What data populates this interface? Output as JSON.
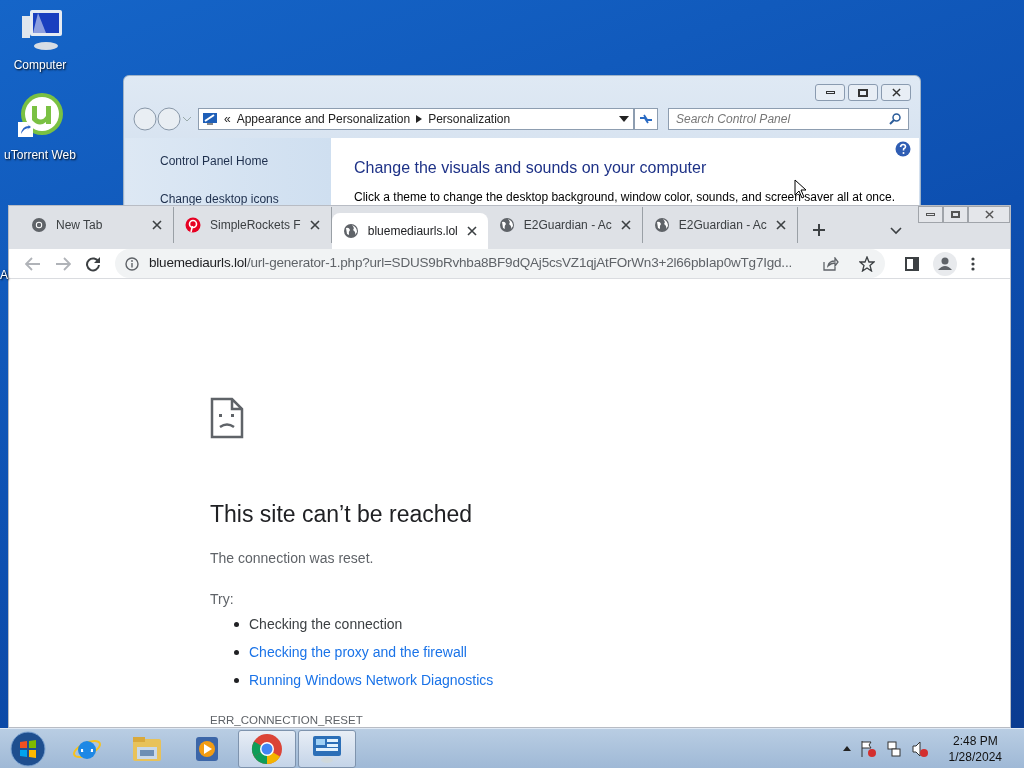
{
  "desktop_icons": [
    {
      "kind": "computer",
      "label": "Computer"
    },
    {
      "kind": "utorrent",
      "label": "uTorrent Web"
    }
  ],
  "partial_desktop_label": "A",
  "control_panel": {
    "breadcrumb_prefix": "«",
    "breadcrumb": [
      "Appearance and Personalization",
      "Personalization"
    ],
    "search": {
      "placeholder": "Search Control Panel"
    },
    "sidebar": [
      "Control Panel Home",
      "Change desktop icons"
    ],
    "heading": "Change the visuals and sounds on your computer",
    "description": "Click a theme to change the desktop background, window color, sounds, and screen saver all at once."
  },
  "browser": {
    "tabs": [
      {
        "kind": "chrome",
        "title": "New Tab",
        "selected": false
      },
      {
        "kind": "pinterest",
        "title": "SimpleRockets F",
        "selected": false
      },
      {
        "kind": "globe",
        "title": "bluemediaurls.lol",
        "selected": true
      },
      {
        "kind": "globe",
        "title": "E2Guardian - Ac",
        "selected": false
      },
      {
        "kind": "globe",
        "title": "E2Guardian - Ac",
        "selected": false
      }
    ],
    "url_host": "bluemediaurls.lol",
    "url_rest": "/url-generator-1.php?url=SDUS9bRvhba8BF9dQAj5csVZ1qjAtFOrWn3+2l66pbIap0wTg7Igd...",
    "error": {
      "title": "This site can’t be reached",
      "message": "The connection was reset.",
      "try_label": "Try:",
      "suggestions": [
        {
          "kind": "plain",
          "text": "Checking the connection"
        },
        {
          "kind": "link",
          "text": "Checking the proxy and the firewall"
        },
        {
          "kind": "link",
          "text": "Running Windows Network Diagnostics"
        }
      ],
      "code": "ERR_CONNECTION_RESET"
    }
  },
  "taskbar": {
    "apps": [
      {
        "kind": "ie",
        "open": false
      },
      {
        "kind": "explorer",
        "open": false
      },
      {
        "kind": "media",
        "open": false
      },
      {
        "kind": "chrome",
        "open": true
      },
      {
        "kind": "control",
        "open": true
      }
    ],
    "time": "2:48 PM",
    "date": "1/28/2024"
  }
}
